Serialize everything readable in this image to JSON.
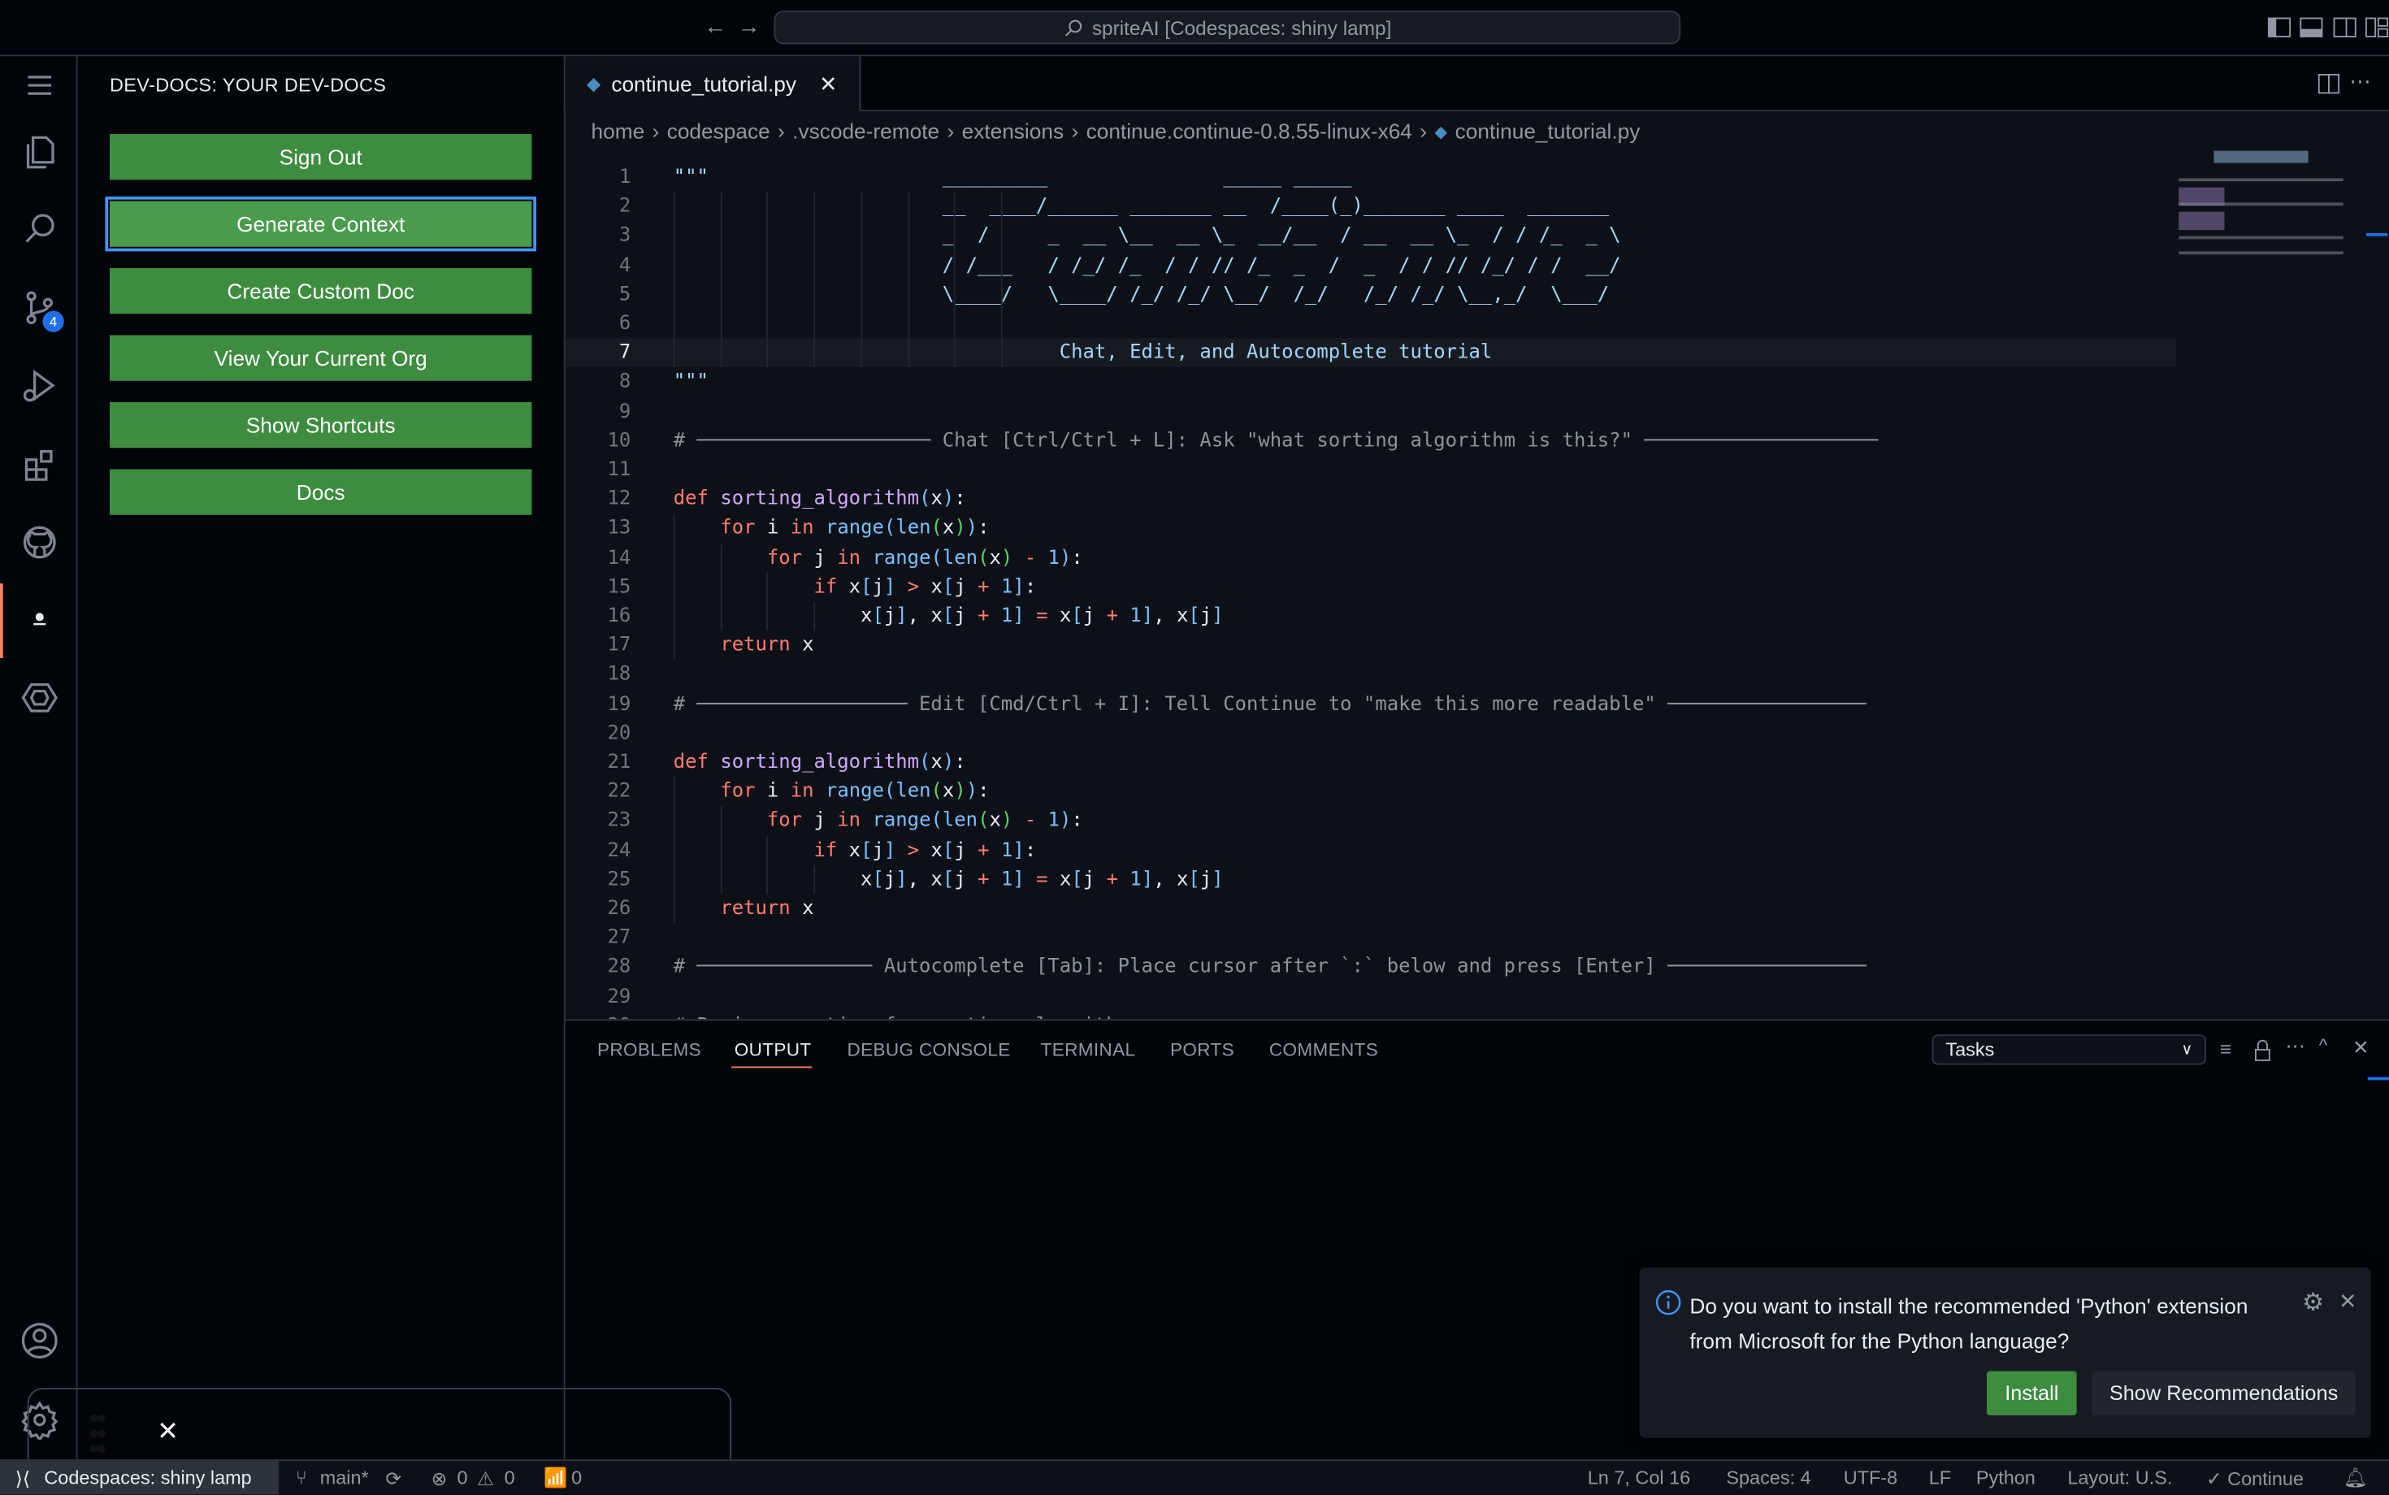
{
  "titlebar": {
    "command_center": "spriteAI [Codespaces: shiny lamp]",
    "back_icon": "arrow-left-icon",
    "forward_icon": "arrow-right-icon"
  },
  "activity_bar": {
    "items": [
      "menu",
      "explorer",
      "search",
      "source-control",
      "run-and-debug",
      "extensions",
      "github",
      "dev-docs",
      "continue",
      "accounts",
      "manage"
    ],
    "source_control_badge": "4",
    "active": "dev-docs"
  },
  "sidebar": {
    "title": "DEV-DOCS: YOUR DEV-DOCS",
    "buttons": [
      "Sign Out",
      "Generate Context",
      "Create Custom Doc",
      "View Your Current Org",
      "Show Shortcuts",
      "Docs"
    ],
    "focused_button": "Generate Context",
    "button_color": "#3d8c40"
  },
  "editor": {
    "tab": "continue_tutorial.py",
    "breadcrumb": [
      "home",
      "codespace",
      ".vscode-remote",
      "extensions",
      "continue.continue-0.8.55-linux-x64",
      "continue_tutorial.py"
    ],
    "current_line": 7,
    "lines": [
      [
        [
          "\"\"\"                    _________               _____ _____",
          "s"
        ]
      ],
      [
        [
          "                       __  ____/______ _______ __  /____(_)_______ ____  _______",
          "s"
        ]
      ],
      [
        [
          "                       _  /     _  __ \\__  __ \\_  __/__  / __  __ \\_  / / /_  _ \\",
          "s"
        ]
      ],
      [
        [
          "                       / /___   / /_/ /_  / / // /_  _  /  _  / / // /_/ / /  __/",
          "s"
        ]
      ],
      [
        [
          "                       \\____/   \\____/ /_/ /_/ \\__/  /_/   /_/ /_/ \\__,_/  \\___/",
          "s"
        ]
      ],
      [
        [
          "",
          "s"
        ]
      ],
      [
        [
          "                                 Chat, Edit, and Autocomplete tutorial",
          "s"
        ]
      ],
      [
        [
          "\"\"\"",
          "s"
        ]
      ],
      [],
      [
        [
          "# ──────────────────── Chat [Ctrl/Ctrl + L]: Ask \"what sorting algorithm is this?\" ────────────────────",
          "c"
        ]
      ],
      [],
      [
        [
          "def",
          "k"
        ],
        [
          " ",
          "p"
        ],
        [
          "sorting_algorithm",
          "f"
        ],
        [
          "(",
          "b"
        ],
        [
          "x",
          "p"
        ],
        [
          ")",
          "b"
        ],
        [
          ":",
          "p"
        ]
      ],
      [
        [
          "    ",
          "p"
        ],
        [
          "for",
          "k"
        ],
        [
          " i ",
          "p"
        ],
        [
          "in",
          "k"
        ],
        [
          " ",
          "p"
        ],
        [
          "range",
          "b"
        ],
        [
          "(",
          "b"
        ],
        [
          "len",
          "b"
        ],
        [
          "(",
          "g"
        ],
        [
          "x",
          "p"
        ],
        [
          ")",
          "g"
        ],
        [
          ")",
          "b"
        ],
        [
          ":",
          "p"
        ]
      ],
      [
        [
          "        ",
          "p"
        ],
        [
          "for",
          "k"
        ],
        [
          " j ",
          "p"
        ],
        [
          "in",
          "k"
        ],
        [
          " ",
          "p"
        ],
        [
          "range",
          "b"
        ],
        [
          "(",
          "b"
        ],
        [
          "len",
          "b"
        ],
        [
          "(",
          "g"
        ],
        [
          "x",
          "p"
        ],
        [
          ")",
          "g"
        ],
        [
          " ",
          "p"
        ],
        [
          "-",
          "o"
        ],
        [
          " ",
          "p"
        ],
        [
          "1",
          "n"
        ],
        [
          ")",
          "b"
        ],
        [
          ":",
          "p"
        ]
      ],
      [
        [
          "            ",
          "p"
        ],
        [
          "if",
          "k"
        ],
        [
          " x",
          "p"
        ],
        [
          "[",
          "b"
        ],
        [
          "j",
          "p"
        ],
        [
          "]",
          "b"
        ],
        [
          " ",
          "p"
        ],
        [
          ">",
          "o"
        ],
        [
          " x",
          "p"
        ],
        [
          "[",
          "b"
        ],
        [
          "j ",
          "p"
        ],
        [
          "+",
          "o"
        ],
        [
          " ",
          "p"
        ],
        [
          "1",
          "n"
        ],
        [
          "]",
          "b"
        ],
        [
          ":",
          "p"
        ]
      ],
      [
        [
          "                x",
          "p"
        ],
        [
          "[",
          "b"
        ],
        [
          "j",
          "p"
        ],
        [
          "]",
          "b"
        ],
        [
          ", x",
          "p"
        ],
        [
          "[",
          "b"
        ],
        [
          "j ",
          "p"
        ],
        [
          "+",
          "o"
        ],
        [
          " ",
          "p"
        ],
        [
          "1",
          "n"
        ],
        [
          "]",
          "b"
        ],
        [
          " ",
          "p"
        ],
        [
          "=",
          "o"
        ],
        [
          " x",
          "p"
        ],
        [
          "[",
          "b"
        ],
        [
          "j ",
          "p"
        ],
        [
          "+",
          "o"
        ],
        [
          " ",
          "p"
        ],
        [
          "1",
          "n"
        ],
        [
          "]",
          "b"
        ],
        [
          ", x",
          "p"
        ],
        [
          "[",
          "b"
        ],
        [
          "j",
          "p"
        ],
        [
          "]",
          "b"
        ]
      ],
      [
        [
          "    ",
          "p"
        ],
        [
          "return",
          "k"
        ],
        [
          " x",
          "p"
        ]
      ],
      [],
      [
        [
          "# ────────────────── Edit [Cmd/Ctrl + I]: Tell Continue to \"make this more readable\" ─────────────────",
          "c"
        ]
      ],
      [],
      [
        [
          "def",
          "k"
        ],
        [
          " ",
          "p"
        ],
        [
          "sorting_algorithm",
          "f"
        ],
        [
          "(",
          "b"
        ],
        [
          "x",
          "p"
        ],
        [
          ")",
          "b"
        ],
        [
          ":",
          "p"
        ]
      ],
      [
        [
          "    ",
          "p"
        ],
        [
          "for",
          "k"
        ],
        [
          " i ",
          "p"
        ],
        [
          "in",
          "k"
        ],
        [
          " ",
          "p"
        ],
        [
          "range",
          "b"
        ],
        [
          "(",
          "b"
        ],
        [
          "len",
          "b"
        ],
        [
          "(",
          "g"
        ],
        [
          "x",
          "p"
        ],
        [
          ")",
          "g"
        ],
        [
          ")",
          "b"
        ],
        [
          ":",
          "p"
        ]
      ],
      [
        [
          "        ",
          "p"
        ],
        [
          "for",
          "k"
        ],
        [
          " j ",
          "p"
        ],
        [
          "in",
          "k"
        ],
        [
          " ",
          "p"
        ],
        [
          "range",
          "b"
        ],
        [
          "(",
          "b"
        ],
        [
          "len",
          "b"
        ],
        [
          "(",
          "g"
        ],
        [
          "x",
          "p"
        ],
        [
          ")",
          "g"
        ],
        [
          " ",
          "p"
        ],
        [
          "-",
          "o"
        ],
        [
          " ",
          "p"
        ],
        [
          "1",
          "n"
        ],
        [
          ")",
          "b"
        ],
        [
          ":",
          "p"
        ]
      ],
      [
        [
          "            ",
          "p"
        ],
        [
          "if",
          "k"
        ],
        [
          " x",
          "p"
        ],
        [
          "[",
          "b"
        ],
        [
          "j",
          "p"
        ],
        [
          "]",
          "b"
        ],
        [
          " ",
          "p"
        ],
        [
          ">",
          "o"
        ],
        [
          " x",
          "p"
        ],
        [
          "[",
          "b"
        ],
        [
          "j ",
          "p"
        ],
        [
          "+",
          "o"
        ],
        [
          " ",
          "p"
        ],
        [
          "1",
          "n"
        ],
        [
          "]",
          "b"
        ],
        [
          ":",
          "p"
        ]
      ],
      [
        [
          "                x",
          "p"
        ],
        [
          "[",
          "b"
        ],
        [
          "j",
          "p"
        ],
        [
          "]",
          "b"
        ],
        [
          ", x",
          "p"
        ],
        [
          "[",
          "b"
        ],
        [
          "j ",
          "p"
        ],
        [
          "+",
          "o"
        ],
        [
          " ",
          "p"
        ],
        [
          "1",
          "n"
        ],
        [
          "]",
          "b"
        ],
        [
          " ",
          "p"
        ],
        [
          "=",
          "o"
        ],
        [
          " x",
          "p"
        ],
        [
          "[",
          "b"
        ],
        [
          "j ",
          "p"
        ],
        [
          "+",
          "o"
        ],
        [
          " ",
          "p"
        ],
        [
          "1",
          "n"
        ],
        [
          "]",
          "b"
        ],
        [
          ", x",
          "p"
        ],
        [
          "[",
          "b"
        ],
        [
          "j",
          "p"
        ],
        [
          "]",
          "b"
        ]
      ],
      [
        [
          "    ",
          "p"
        ],
        [
          "return",
          "k"
        ],
        [
          " x",
          "p"
        ]
      ],
      [],
      [
        [
          "# ─────────────── Autocomplete [Tab]: Place cursor after `:` below and press [Enter] ─────────────────",
          "c"
        ]
      ],
      [],
      [
        [
          "# Basic assertion for sorting_algorithm:",
          "c"
        ]
      ]
    ]
  },
  "panel": {
    "tabs": [
      "PROBLEMS",
      "OUTPUT",
      "DEBUG CONSOLE",
      "TERMINAL",
      "PORTS",
      "COMMENTS"
    ],
    "active_tab": "OUTPUT",
    "output_channel": "Tasks",
    "accent": "#f78166"
  },
  "notification": {
    "message_line1": "Do you want to install the recommended 'Python' extension",
    "message_line2": "from Microsoft for the Python language?",
    "install": "Install",
    "show_recommendations": "Show Recommendations"
  },
  "statusbar": {
    "remote": "Codespaces: shiny lamp",
    "branch": "main*",
    "errors": "0",
    "warnings": "0",
    "ports": "0",
    "position": "Ln 7, Col 16",
    "spaces": "Spaces: 4",
    "encoding": "UTF-8",
    "eol": "LF",
    "language": "Python",
    "layout": "Layout: U.S.",
    "continue": "✓ Continue"
  }
}
